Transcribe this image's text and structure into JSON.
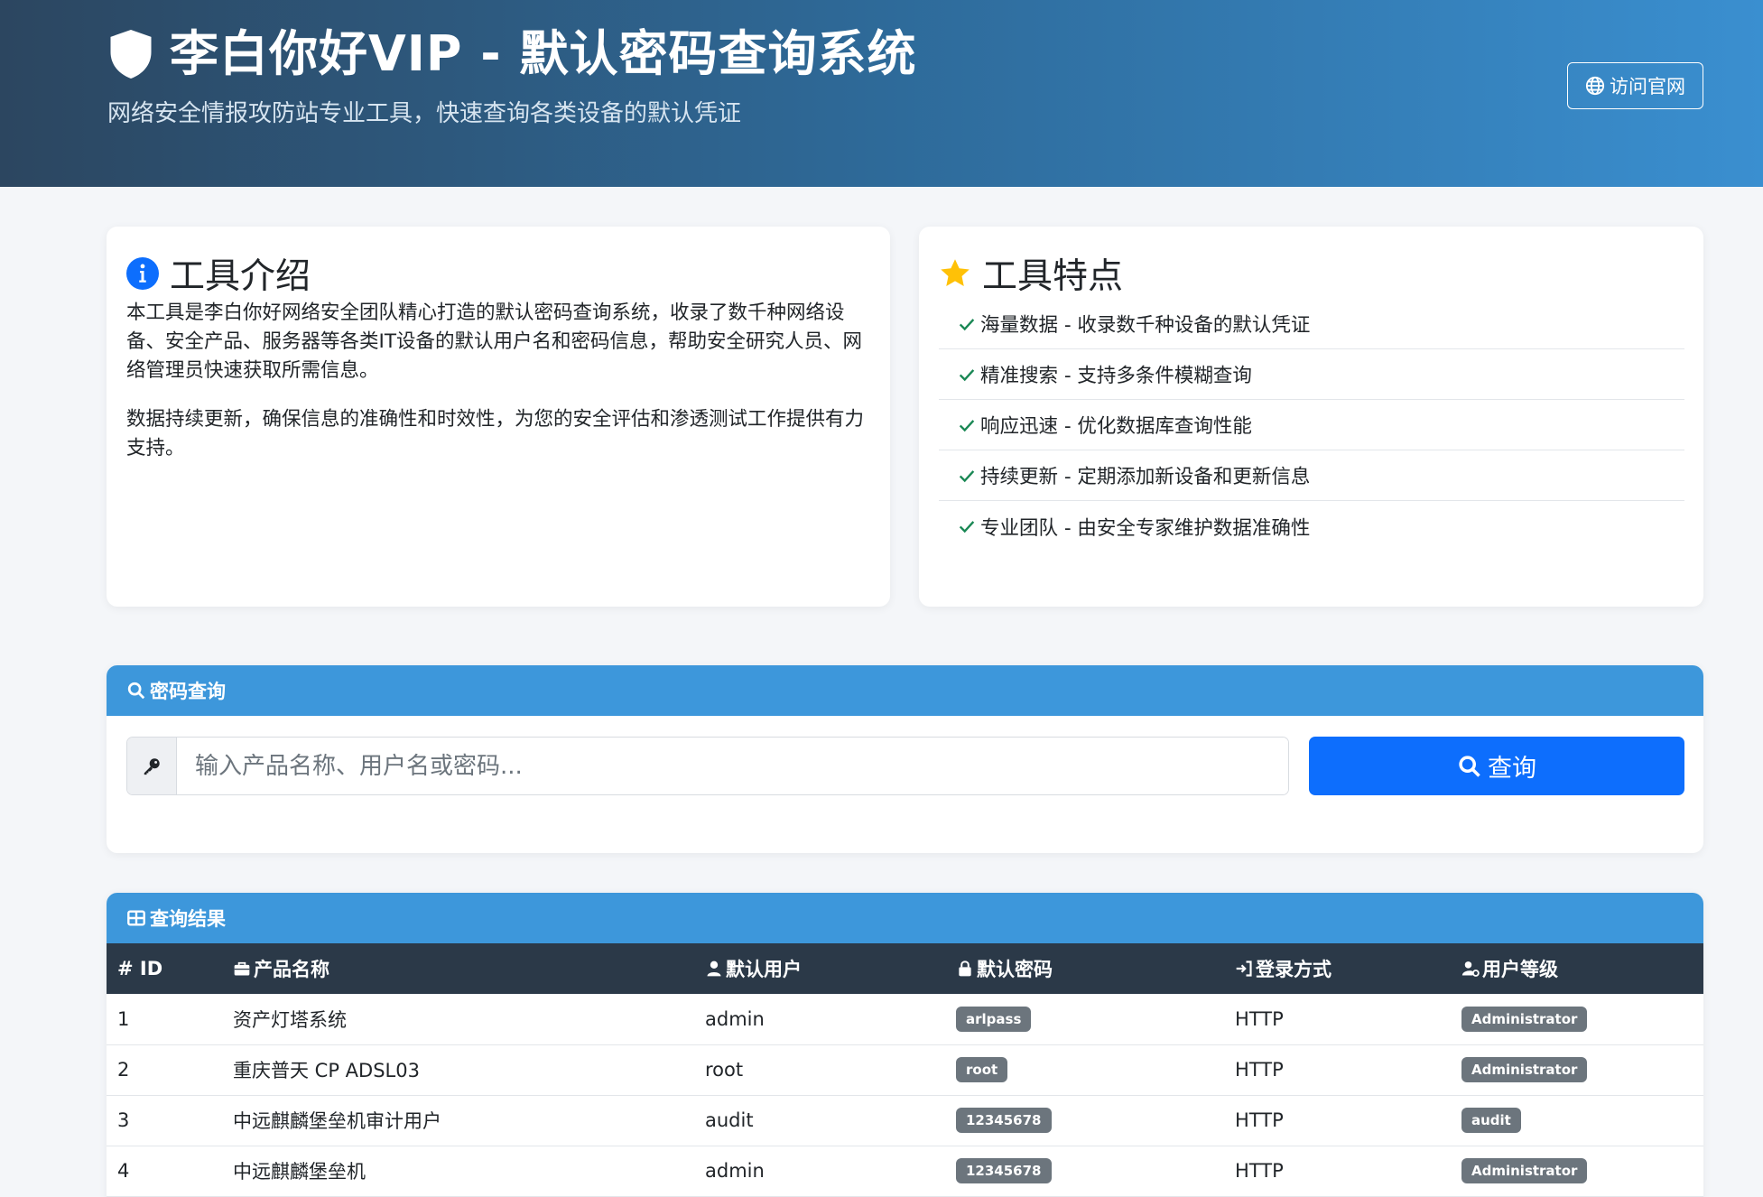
{
  "header": {
    "title": "李白你好VIP - 默认密码查询系统",
    "subtitle": "网络安全情报攻防站专业工具，快速查询各类设备的默认凭证",
    "visit_button": "访问官网"
  },
  "intro": {
    "heading": "工具介绍",
    "paragraphs": [
      "本工具是李白你好网络安全团队精心打造的默认密码查询系统，收录了数千种网络设备、安全产品、服务器等各类IT设备的默认用户名和密码信息，帮助安全研究人员、网络管理员快速获取所需信息。",
      "数据持续更新，确保信息的准确性和时效性，为您的安全评估和渗透测试工作提供有力支持。"
    ]
  },
  "features": {
    "heading": "工具特点",
    "items": [
      "海量数据 - 收录数千种设备的默认凭证",
      "精准搜索 - 支持多条件模糊查询",
      "响应迅速 - 优化数据库查询性能",
      "持续更新 - 定期添加新设备和更新信息",
      "专业团队 - 由安全专家维护数据准确性"
    ]
  },
  "search": {
    "panel_title": "密码查询",
    "placeholder": "输入产品名称、用户名或密码...",
    "button_label": "查询"
  },
  "results": {
    "panel_title": "查询结果",
    "columns": [
      "# ID",
      "产品名称",
      "默认用户",
      "默认密码",
      "登录方式",
      "用户等级"
    ],
    "rows": [
      {
        "id": "1",
        "product": "资产灯塔系统",
        "user": "admin",
        "password": "arlpass",
        "method": "HTTP",
        "level": "Administrator"
      },
      {
        "id": "2",
        "product": "重庆普天 CP ADSL03",
        "user": "root",
        "password": "root",
        "method": "HTTP",
        "level": "Administrator"
      },
      {
        "id": "3",
        "product": "中远麒麟堡垒机审计用户",
        "user": "audit",
        "password": "12345678",
        "method": "HTTP",
        "level": "audit"
      },
      {
        "id": "4",
        "product": "中远麒麟堡垒机",
        "user": "admin",
        "password": "12345678",
        "method": "HTTP",
        "level": "Administrator"
      }
    ]
  },
  "icons": {
    "header": "shield-icon",
    "visit": "globe-icon",
    "intro": "info-circle-icon",
    "features": "star-icon",
    "feature_item": "check-icon",
    "search_panel": "search-icon",
    "key": "key-icon",
    "results_panel": "table-icon"
  },
  "colors": {
    "header_gradient_start": "#2c4660",
    "header_gradient_end": "#3a8fd0",
    "panel_head": "#3d97db",
    "table_head": "#2b3948",
    "primary_button": "#0d6efd",
    "info_icon": "#0d6efd",
    "star": "#ffc107",
    "check": "#198754",
    "badge": "#6c757d"
  }
}
